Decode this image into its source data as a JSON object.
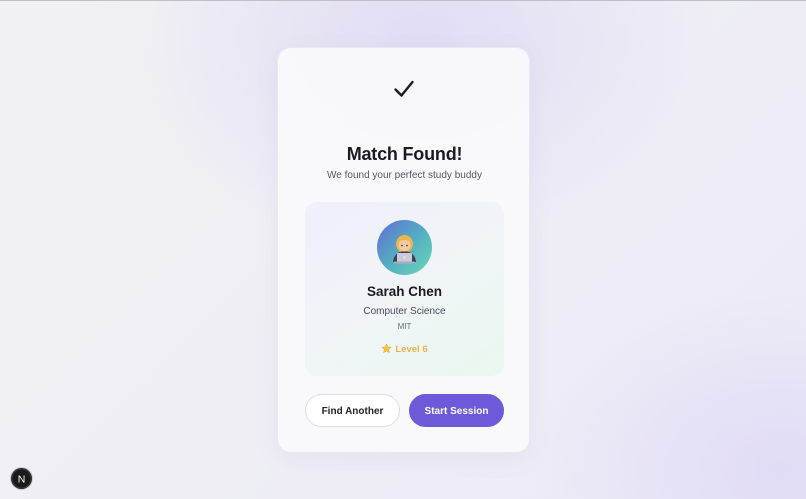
{
  "match": {
    "title": "Match Found!",
    "subtitle": "We found your perfect study buddy"
  },
  "profile": {
    "avatar_icon": "person-with-laptop-icon",
    "name": "Sarah Chen",
    "major": "Computer Science",
    "school": "MIT",
    "level_icon": "star-icon",
    "level_label": "Level 6"
  },
  "actions": {
    "find_another_label": "Find Another",
    "start_session_label": "Start Session"
  },
  "colors": {
    "accent": "#6c5ad8",
    "level": "#f0b24a",
    "text_dark": "#1b1b24"
  },
  "badge": {
    "icon": "nextjs-icon",
    "letter": "N"
  }
}
